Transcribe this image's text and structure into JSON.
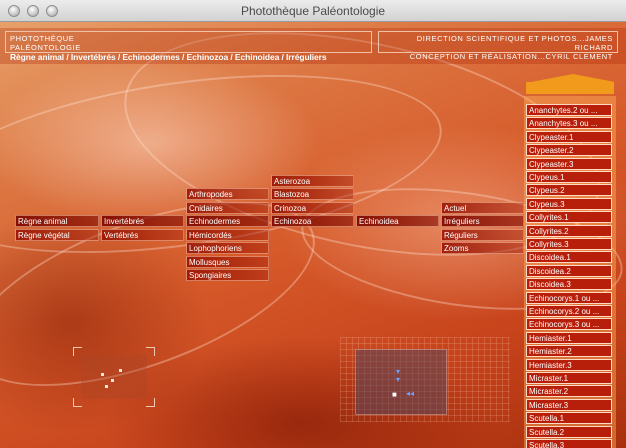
{
  "window": {
    "title": "Photothèque Paléontologie"
  },
  "header": {
    "left_line1": "Photothèque",
    "left_line2": "Paléontologie",
    "right_line1": "Direction scientifique et photos...James Richard",
    "right_line2": "Conception et réalisation...Cyril Clement",
    "breadcrumb": "Règne animal / Invertébrés / Echinodermes / Echinozoa / Echinoidea / Irréguliers"
  },
  "menu": {
    "col1": [
      "Règne animal",
      "Règne végétal"
    ],
    "col2": [
      "Invertébrés",
      "Vertébrés"
    ],
    "col3": [
      "Arthropodes",
      "Cnidaires",
      "Echinodermes",
      "Hémicordés",
      "Lophophoriens",
      "Mollusques",
      "Spongiaires"
    ],
    "col4": [
      "Asterozoa",
      "Blastozoa",
      "Crinozoa",
      "Echinozoa"
    ],
    "col5": [
      "Echinoidea"
    ],
    "col6": [
      "Actuel",
      "Irréguliers",
      "Réguliers",
      "Zooms"
    ]
  },
  "specimens": [
    "Ananchytes.2 ou ...",
    "Ananchytes.3 ou ...",
    "Clypeaster.1",
    "Clypeaster.2",
    "Clypeaster.3",
    "Clypeus.1",
    "Clypeus.2",
    "Clypeus.3",
    "Collyrites.1",
    "Collyrites.2",
    "Collyrites.3",
    "Discoidea.1",
    "Discoidea.2",
    "Discoidea.3",
    "Echinocorys.1 ou ...",
    "Echinocorys.2 ou ...",
    "Echinocorys.3 ou ...",
    "Hemiaster.1",
    "Hemiaster.2",
    "Hemiaster.3",
    "Micraster.1",
    "Micraster.2",
    "Micraster.3",
    "Scutella.1",
    "Scutella.2",
    "Scutella.3"
  ],
  "colors": {
    "scroll_arrow": "#f29a1c",
    "specimen_bg": "#b81f0a",
    "radar_icon": "#6aa0ff"
  }
}
